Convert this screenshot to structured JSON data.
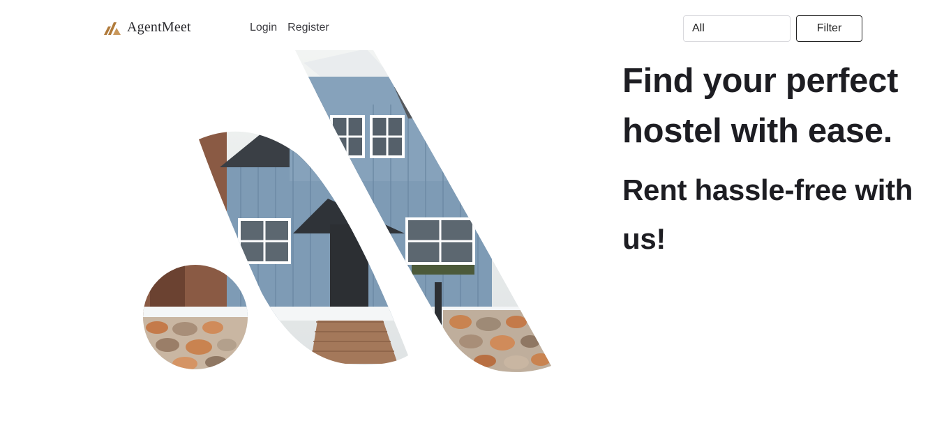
{
  "brand": {
    "name": "AgentMeet",
    "logo_icon": "agentmeet-logo-icon",
    "logo_color": "#b07a3a"
  },
  "nav": {
    "links": [
      {
        "label": "Login"
      },
      {
        "label": "Register"
      }
    ]
  },
  "filter": {
    "selected": "All",
    "button_label": "Filter"
  },
  "hero": {
    "image_icon": "house-photo-collage",
    "headline": "Find your perfect hostel with ease.",
    "subheadline": "Rent hassle-free with us!"
  }
}
